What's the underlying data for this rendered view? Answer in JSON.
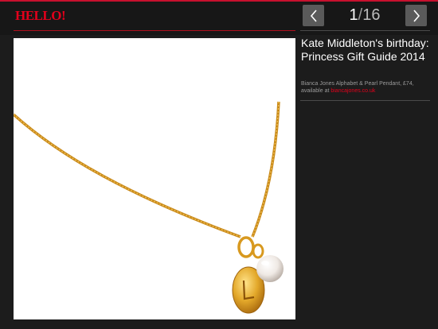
{
  "header": {
    "logo": "HELLO!",
    "counter": {
      "current": "1",
      "separator": "/",
      "total": "16"
    },
    "prev_icon": "chevron-left-icon",
    "next_icon": "chevron-right-icon"
  },
  "gallery": {
    "image_subject": "necklace-image"
  },
  "caption": {
    "title": "Kate Middleton's birthday: Princess Gift Guide 2014",
    "description": "Bianca Jones Alphabet & Pearl Pendant, £74, available at ",
    "link_text": "biancajones.co.uk"
  },
  "colors": {
    "brand": "#e3001b",
    "background": "#1c1c1c",
    "button": "#5a5a5a"
  }
}
